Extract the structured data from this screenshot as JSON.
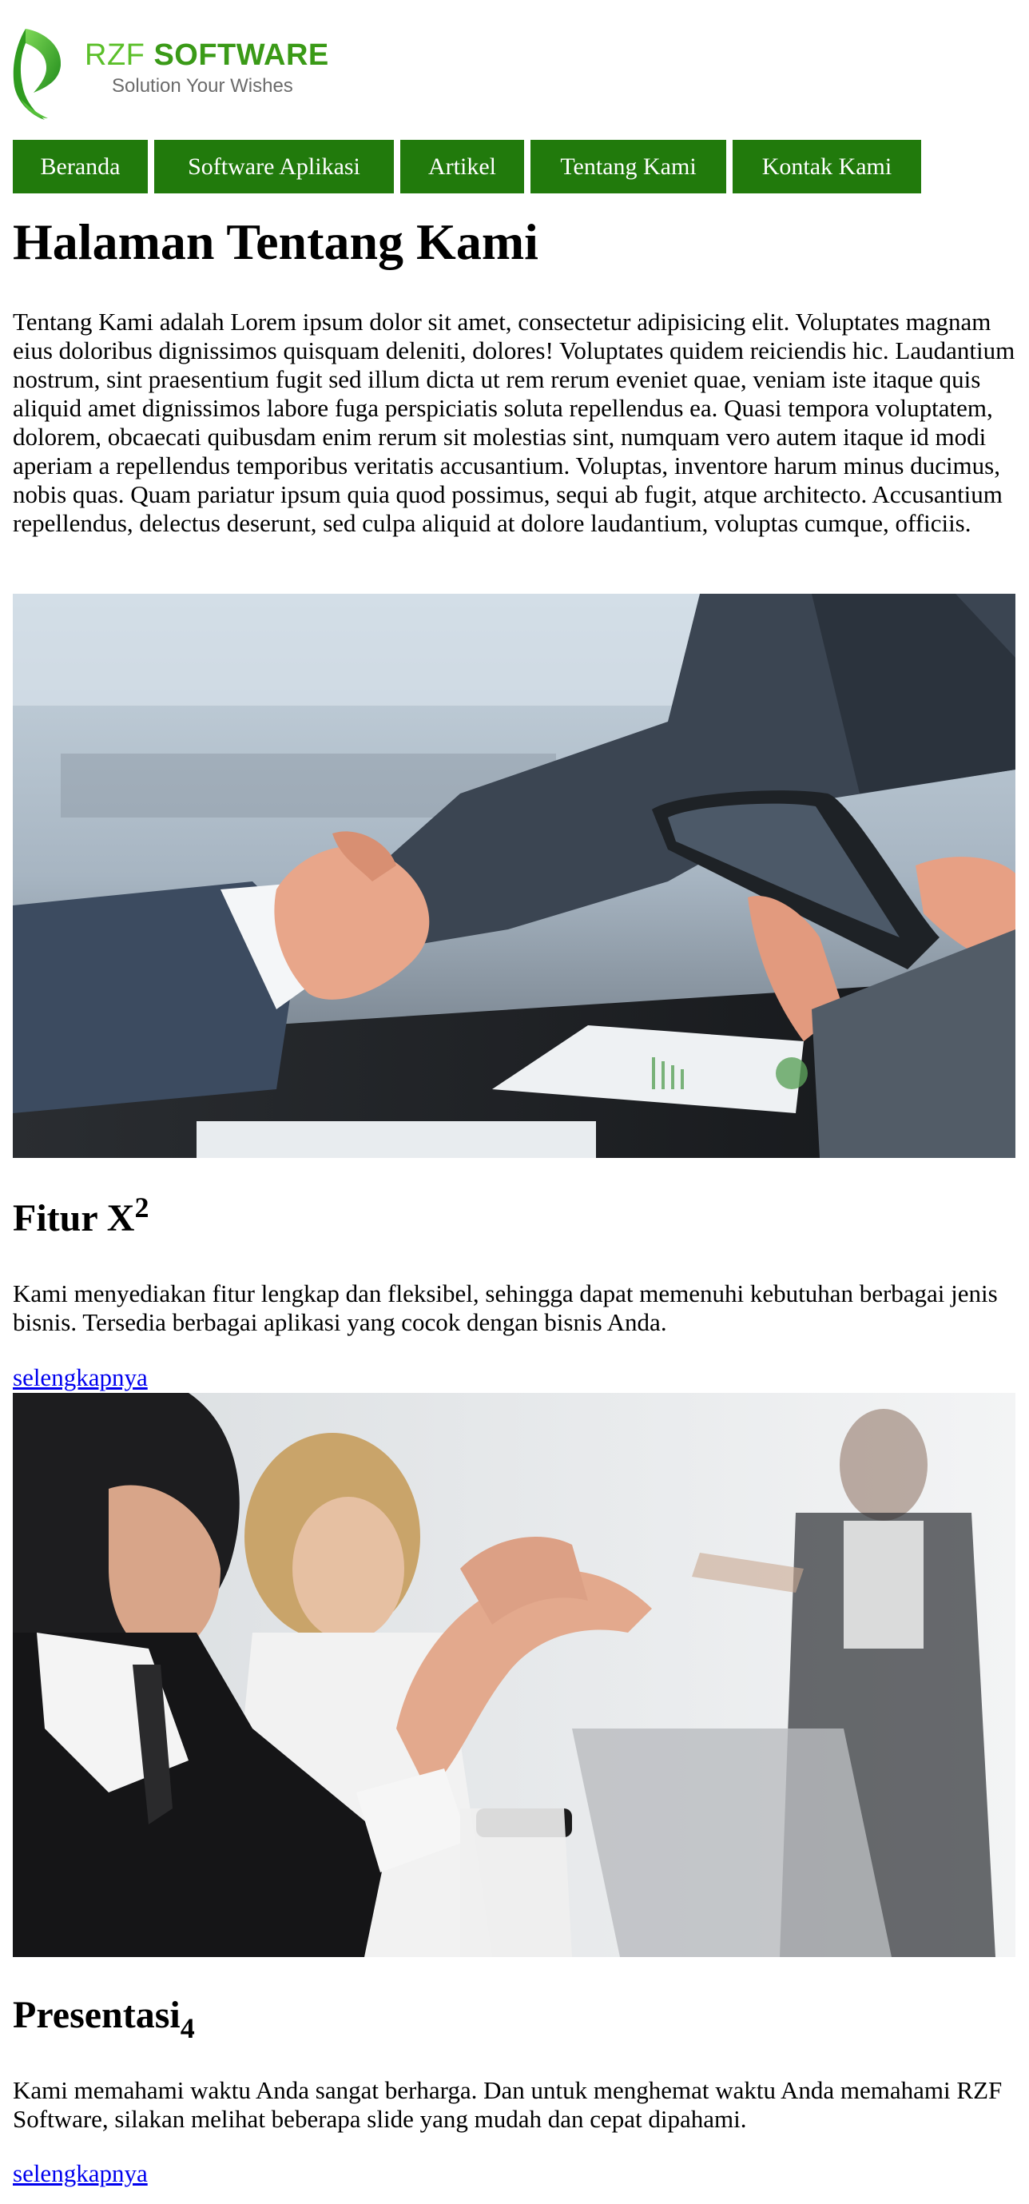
{
  "logo": {
    "name_part1": "RZF ",
    "name_part2": "SOFTWARE",
    "tagline": "Solution Your Wishes",
    "colors": {
      "light_green": "#5bbf2a",
      "dark_green": "#3a9a17",
      "tagline_gray": "#6b6b6b"
    }
  },
  "nav": {
    "background": "#217a0c",
    "items": [
      {
        "label": "Beranda"
      },
      {
        "label": "Software Aplikasi"
      },
      {
        "label": "Artikel"
      },
      {
        "label": "Tentang Kami"
      },
      {
        "label": "Kontak Kami"
      }
    ]
  },
  "page_title": "Halaman Tentang Kami",
  "intro": "Tentang Kami adalah Lorem ipsum dolor sit amet, consectetur adipisicing elit. Voluptates magnam eius doloribus dignissimos quisquam deleniti, dolores! Voluptates quidem reiciendis hic. Laudantium nostrum, sint praesentium fugit sed illum dicta ut rem rerum eveniet quae, veniam iste itaque quis aliquid amet dignissimos labore fuga perspiciatis soluta repellendus ea. Quasi tempora voluptatem, dolorem, obcaecati quibusdam enim rerum sit molestias sint, numquam vero autem itaque id modi aperiam a repellendus temporibus veritatis accusantium. Voluptas, inventore harum minus ducimus, nobis quas. Quam pariatur ipsum quia quod possimus, sequi ab fugit, atque architecto. Accusantium repellendus, delectus deserunt, sed culpa aliquid at dolore laudantium, voluptas cumque, officiis.",
  "sections": {
    "fitur": {
      "title": "Fitur X",
      "title_superscript": "2",
      "text": "Kami menyediakan fitur lengkap dan fleksibel, sehingga dapat memenuhi kebutuhan berbagai jenis bisnis. Tersedia berbagai aplikasi yang cocok dengan bisnis Anda.",
      "link": "selengkapnya"
    },
    "presentasi": {
      "title": "Presentasi",
      "title_subscript": "4",
      "text": "Kami memahami waktu Anda sangat berharga. Dan untuk menghemat waktu Anda memahami RZF Software, silakan melihat beberapa slide yang mudah dan cepat dipahami.",
      "link": "selengkapnya"
    }
  },
  "link_color": "#0000ee"
}
